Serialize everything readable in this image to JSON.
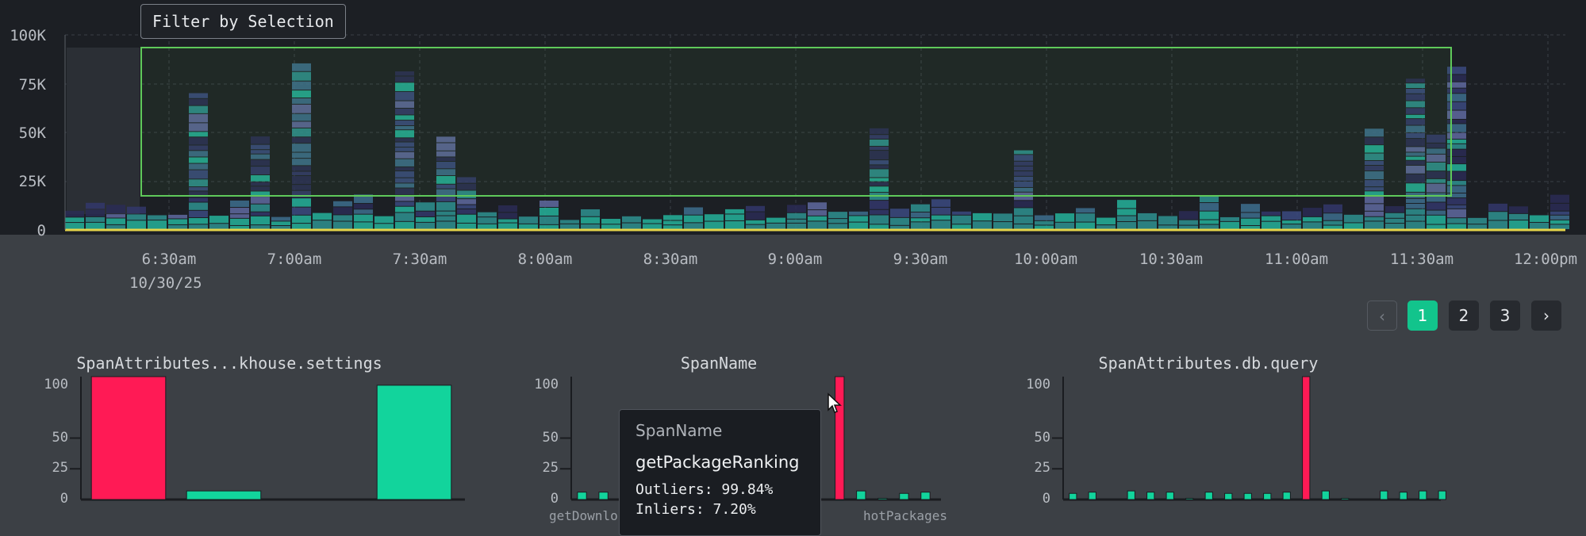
{
  "filter_button_label": "Filter by Selection",
  "heatmap": {
    "y_ticks": [
      "100K",
      "75K",
      "50K",
      "25K",
      "0"
    ],
    "x_ticks": [
      "6:30am",
      "7:00am",
      "7:30am",
      "8:00am",
      "8:30am",
      "9:00am",
      "9:30am",
      "10:00am",
      "10:30am",
      "11:00am",
      "11:30am",
      "12:00pm"
    ],
    "date": "10/30/25"
  },
  "pagination": {
    "prev": "‹",
    "pages": [
      "1",
      "2",
      "3"
    ],
    "active_page": "1",
    "next": "›"
  },
  "charts": [
    {
      "title": "SpanAttributes...khouse.settings",
      "y_ticks": [
        "100",
        "50",
        "25",
        "0"
      ],
      "x_labels": [],
      "bars": [
        {
          "series": "outlier",
          "value": 100
        },
        {
          "series": "inlier",
          "value": 7
        },
        {
          "series": "inlier",
          "value": 0
        },
        {
          "series": "inlier",
          "value": 93
        }
      ]
    },
    {
      "title": "SpanName",
      "y_ticks": [
        "100",
        "50",
        "25",
        "0"
      ],
      "x_labels": [
        "getDownlo",
        "hotPackages"
      ],
      "bars": [
        {
          "series": "inlier",
          "value": 6
        },
        {
          "series": "inlier",
          "value": 6
        },
        {
          "series": "inlier",
          "value": 0
        },
        {
          "series": "inlier",
          "value": 0
        },
        {
          "series": "inlier",
          "value": 0
        },
        {
          "series": "inlier",
          "value": 0
        },
        {
          "series": "inlier",
          "value": 0
        },
        {
          "series": "inlier",
          "value": 0
        },
        {
          "series": "inlier",
          "value": 0
        },
        {
          "series": "inlier",
          "value": 0
        },
        {
          "series": "inlier",
          "value": 0
        },
        {
          "series": "inlier",
          "value": 0
        },
        {
          "series": "outlier",
          "value": 100
        },
        {
          "series": "inlier",
          "value": 7
        },
        {
          "series": "inlier",
          "value": 1
        },
        {
          "series": "inlier",
          "value": 5
        },
        {
          "series": "inlier",
          "value": 6
        }
      ]
    },
    {
      "title": "SpanAttributes.db.query",
      "y_ticks": [
        "100",
        "50",
        "25",
        "0"
      ],
      "x_labels": [],
      "bars": [
        {
          "series": "inlier",
          "value": 5
        },
        {
          "series": "inlier",
          "value": 6
        },
        {
          "series": "inlier",
          "value": 0
        },
        {
          "series": "inlier",
          "value": 7
        },
        {
          "series": "inlier",
          "value": 6
        },
        {
          "series": "inlier",
          "value": 6
        },
        {
          "series": "inlier",
          "value": 1
        },
        {
          "series": "inlier",
          "value": 6
        },
        {
          "series": "inlier",
          "value": 5
        },
        {
          "series": "inlier",
          "value": 5
        },
        {
          "series": "inlier",
          "value": 5
        },
        {
          "series": "inlier",
          "value": 6
        },
        {
          "series": "outlier",
          "value": 100
        },
        {
          "series": "inlier",
          "value": 7
        },
        {
          "series": "inlier",
          "value": 1
        },
        {
          "series": "inlier",
          "value": 0
        },
        {
          "series": "inlier",
          "value": 7
        },
        {
          "series": "inlier",
          "value": 6
        },
        {
          "series": "inlier",
          "value": 7
        },
        {
          "series": "inlier",
          "value": 7
        }
      ]
    }
  ],
  "tooltip": {
    "title": "SpanName",
    "name": "getPackageRanking",
    "outliers": "Outliers: 99.84%",
    "inliers": "Inliers: 7.20%"
  },
  "colors": {
    "outlier": "#ff1a55",
    "inlier": "#12d49c",
    "selection": "#5fc95a",
    "accent": "#12c48c"
  }
}
